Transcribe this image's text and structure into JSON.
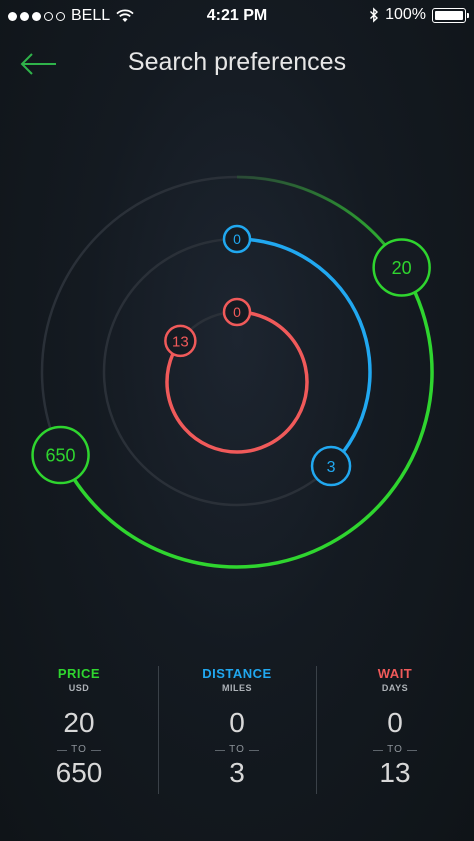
{
  "status": {
    "carrier": "BELL",
    "time": "4:21 PM",
    "battery": "100%"
  },
  "nav": {
    "title": "Search preferences"
  },
  "colors": {
    "price": "#2fd52f",
    "distance": "#21a8f0",
    "wait": "#f05a5a",
    "track": "#2a3038"
  },
  "dial": {
    "price": {
      "from": "20",
      "to": "650",
      "from_fraction": 0.16,
      "to_fraction": 0.68
    },
    "distance": {
      "from": "0",
      "to": "3",
      "from_fraction": 0.0,
      "to_fraction": 0.375
    },
    "wait": {
      "from": "0",
      "to": "13",
      "from_fraction": 0.0,
      "to_fraction": 0.85
    }
  },
  "stats": [
    {
      "label": "PRICE",
      "unit": "USD",
      "from": "20",
      "to_word": "TO",
      "to": "650",
      "color": "#2fd52f"
    },
    {
      "label": "DISTANCE",
      "unit": "MILES",
      "from": "0",
      "to_word": "TO",
      "to": "3",
      "color": "#21a8f0"
    },
    {
      "label": "WAIT",
      "unit": "DAYS",
      "from": "0",
      "to_word": "TO",
      "to": "13",
      "color": "#f05a5a"
    }
  ]
}
